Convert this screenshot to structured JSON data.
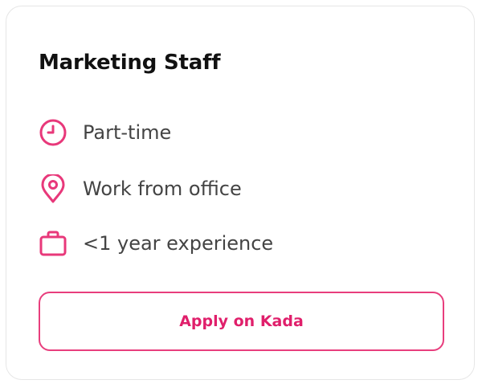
{
  "job": {
    "title": "Marketing Staff",
    "details": [
      {
        "icon": "clock-icon",
        "text": "Part-time"
      },
      {
        "icon": "location-pin-icon",
        "text": "Work from office"
      },
      {
        "icon": "briefcase-icon",
        "text": "<1 year experience"
      }
    ],
    "apply_label": "Apply on Kada"
  },
  "colors": {
    "accent": "#e01f6b",
    "icon": "#e8387a",
    "text": "#444444",
    "title": "#111111"
  }
}
